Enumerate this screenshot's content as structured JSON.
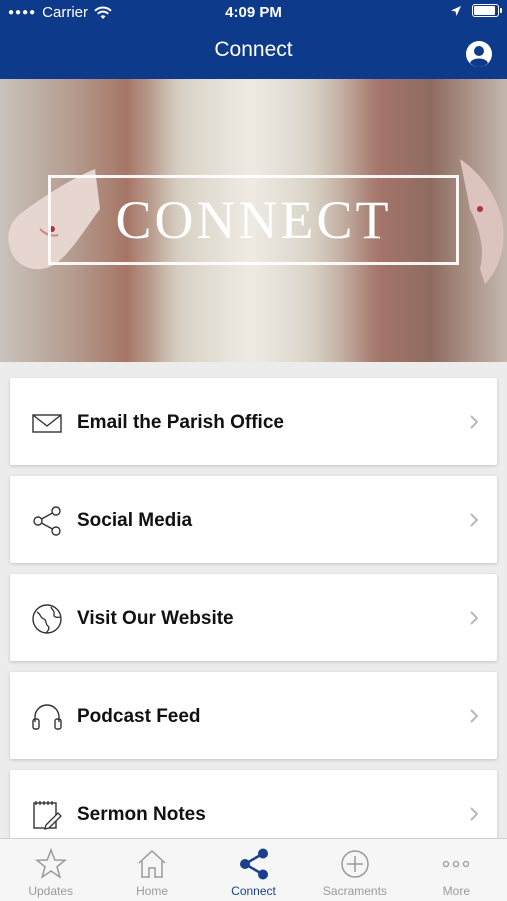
{
  "status": {
    "carrier": "Carrier",
    "time": "4:09 PM",
    "battery_level": 0.9
  },
  "nav": {
    "title": "Connect",
    "profile_icon": "person-circle-icon"
  },
  "hero": {
    "title": "CONNECT"
  },
  "items": [
    {
      "label": "Email the Parish Office",
      "icon": "envelope-icon"
    },
    {
      "label": "Social Media",
      "icon": "share-icon"
    },
    {
      "label": "Visit Our Website",
      "icon": "globe-icon"
    },
    {
      "label": "Podcast Feed",
      "icon": "headphones-icon"
    },
    {
      "label": "Sermon Notes",
      "icon": "notepad-icon"
    }
  ],
  "tabs": [
    {
      "label": "Updates",
      "icon": "star-icon"
    },
    {
      "label": "Home",
      "icon": "house-icon"
    },
    {
      "label": "Connect",
      "icon": "share-icon",
      "active": true
    },
    {
      "label": "Sacraments",
      "icon": "plus-circle-icon"
    },
    {
      "label": "More",
      "icon": "ellipsis-icon"
    }
  ],
  "colors": {
    "nav_bg": "#0e3a8c",
    "active_tab": "#1a3f8f",
    "inactive_tab": "#9a9a9a"
  }
}
